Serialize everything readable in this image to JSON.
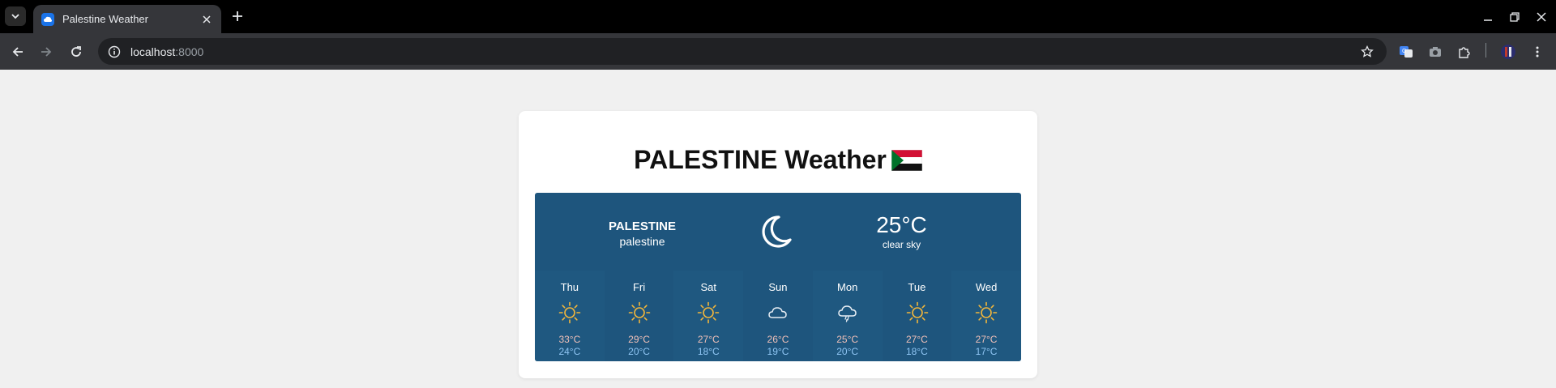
{
  "browser": {
    "tab_title": "Palestine Weather",
    "url_host": "localhost",
    "url_port": ":8000"
  },
  "page": {
    "title": "PALESTINE Weather",
    "flag_icon": "flag-icon"
  },
  "current": {
    "location": "PALESTINE",
    "sublocation": "palestine",
    "icon": "moon-icon",
    "temp": "25°C",
    "description": "clear sky"
  },
  "forecast": [
    {
      "day": "Thu",
      "icon": "sun-icon",
      "high": "33°C",
      "low": "24°C"
    },
    {
      "day": "Fri",
      "icon": "sun-icon",
      "high": "29°C",
      "low": "20°C"
    },
    {
      "day": "Sat",
      "icon": "sun-icon",
      "high": "27°C",
      "low": "18°C"
    },
    {
      "day": "Sun",
      "icon": "cloud-icon",
      "high": "26°C",
      "low": "19°C"
    },
    {
      "day": "Mon",
      "icon": "rain-cloud-icon",
      "high": "25°C",
      "low": "20°C"
    },
    {
      "day": "Tue",
      "icon": "sun-icon",
      "high": "27°C",
      "low": "18°C"
    },
    {
      "day": "Wed",
      "icon": "sun-icon",
      "high": "27°C",
      "low": "17°C"
    }
  ],
  "colors": {
    "widget_bg": "#1e557d",
    "sun": "#f4b73a",
    "high_temp": "#f0c0b8",
    "low_temp": "#8ec4f2"
  }
}
